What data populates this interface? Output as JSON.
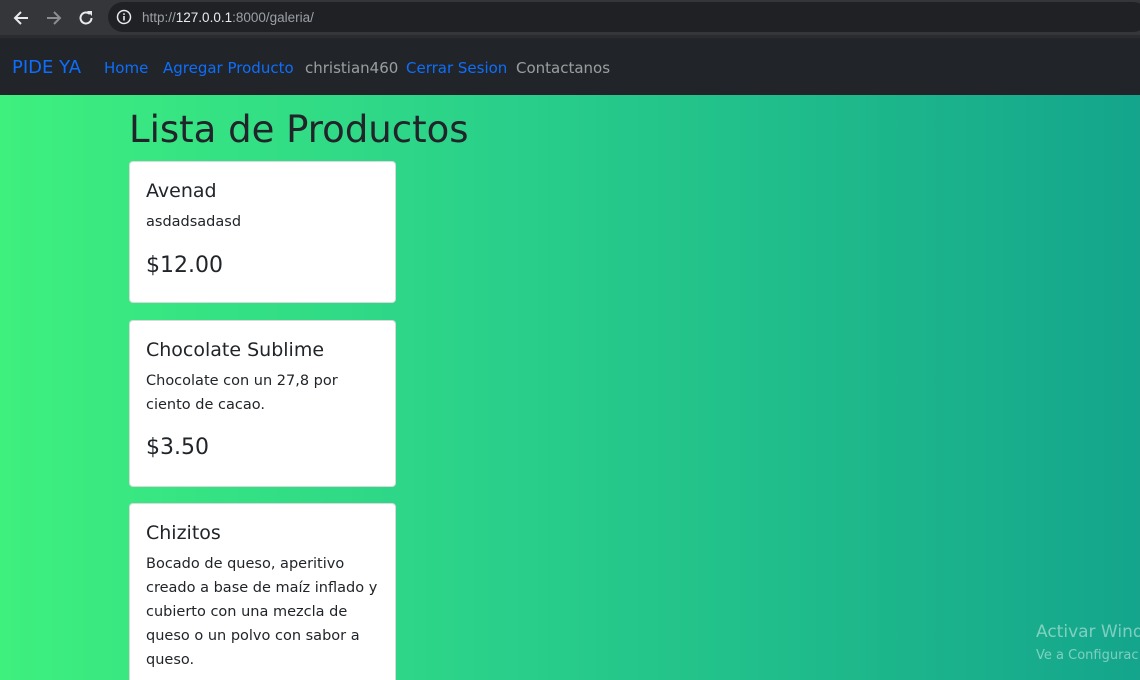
{
  "browser": {
    "url_scheme": "http://",
    "url_host": "127.0.0.1",
    "url_rest": ":8000/galeria/"
  },
  "navbar": {
    "brand": "PIDE YA",
    "links": [
      {
        "label": "Home",
        "color": "#0d6efd"
      },
      {
        "label": "Agregar Producto",
        "color": "#0d6efd"
      },
      {
        "label": "christian460",
        "color": "#8c8e90"
      },
      {
        "label": "Cerrar Sesion",
        "color": "#0d6efd"
      },
      {
        "label": "Contactanos",
        "color": "#8c8e90"
      }
    ]
  },
  "main": {
    "title": "Lista de Productos",
    "products": [
      {
        "name": "Avenad",
        "description": "asdadsadasd",
        "price": "$12.00"
      },
      {
        "name": "Chocolate Sublime",
        "description": "Chocolate con un 27,8 por ciento de cacao.",
        "price": "$3.50"
      },
      {
        "name": "Chizitos",
        "description": "Bocado de queso, aperitivo creado a base de maíz inflado y cubierto con una mezcla de queso o un polvo con sabor a queso.",
        "price": ""
      }
    ]
  },
  "watermark": {
    "line1": "Activar Wind",
    "line2": "Ve a Configurac"
  },
  "colors": {
    "navbar_bg": "#212529",
    "link_blue": "#0d6efd",
    "gradient_start": "#3ef07e",
    "gradient_end": "#14a58c"
  }
}
